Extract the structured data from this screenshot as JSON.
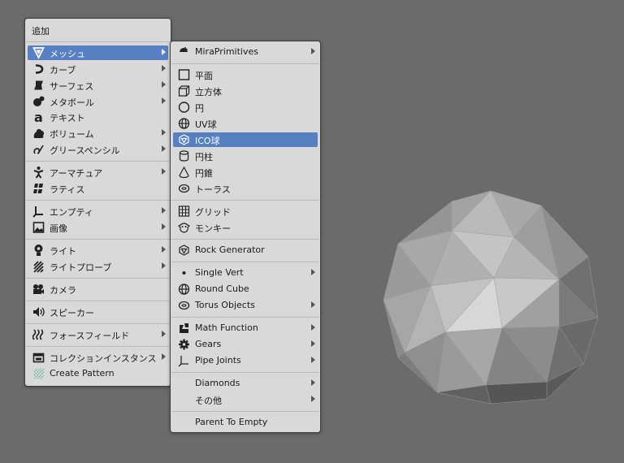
{
  "add_menu": {
    "title": "追加",
    "items": [
      {
        "label": "メッシュ",
        "icon": "mesh-icon",
        "submenu": true,
        "active": true
      },
      {
        "label": "カーブ",
        "icon": "curve-icon",
        "submenu": true
      },
      {
        "label": "サーフェス",
        "icon": "surface-icon",
        "submenu": true
      },
      {
        "label": "メタボール",
        "icon": "metaball-icon",
        "submenu": true
      },
      {
        "label": "テキスト",
        "icon": "text-icon",
        "submenu": false
      },
      {
        "label": "ボリューム",
        "icon": "volume-icon",
        "submenu": true
      },
      {
        "label": "グリースペンシル",
        "icon": "grease-pencil-icon",
        "submenu": true
      },
      {
        "label": "アーマチュア",
        "icon": "armature-icon",
        "submenu": true
      },
      {
        "label": "ラティス",
        "icon": "lattice-icon",
        "submenu": false
      },
      {
        "label": "エンプティ",
        "icon": "empty-icon",
        "submenu": true
      },
      {
        "label": "画像",
        "icon": "image-icon",
        "submenu": true
      },
      {
        "label": "ライト",
        "icon": "light-icon",
        "submenu": true
      },
      {
        "label": "ライトプローブ",
        "icon": "light-probe-icon",
        "submenu": true
      },
      {
        "label": "カメラ",
        "icon": "camera-icon",
        "submenu": false
      },
      {
        "label": "スピーカー",
        "icon": "speaker-icon",
        "submenu": false
      },
      {
        "label": "フォースフィールド",
        "icon": "force-field-icon",
        "submenu": true
      },
      {
        "label": "コレクションインスタンス",
        "icon": "collection-instance-icon",
        "submenu": true
      },
      {
        "label": "Create Pattern",
        "icon": "create-pattern-icon",
        "submenu": false
      }
    ]
  },
  "mesh_menu": {
    "items": [
      {
        "label": "MiraPrimitives",
        "icon": "mira-primitives-icon",
        "submenu": true
      },
      {
        "label": "平面",
        "icon": "plane-icon",
        "submenu": false
      },
      {
        "label": "立方体",
        "icon": "cube-icon",
        "submenu": false
      },
      {
        "label": "円",
        "icon": "circle-icon",
        "submenu": false
      },
      {
        "label": "UV球",
        "icon": "uv-sphere-icon",
        "submenu": false
      },
      {
        "label": "ICO球",
        "icon": "ico-sphere-icon",
        "submenu": false,
        "active": true
      },
      {
        "label": "円柱",
        "icon": "cylinder-icon",
        "submenu": false
      },
      {
        "label": "円錐",
        "icon": "cone-icon",
        "submenu": false
      },
      {
        "label": "トーラス",
        "icon": "torus-icon",
        "submenu": false
      },
      {
        "label": "グリッド",
        "icon": "grid-icon",
        "submenu": false
      },
      {
        "label": "モンキー",
        "icon": "monkey-icon",
        "submenu": false
      },
      {
        "label": "Rock Generator",
        "icon": "rock-generator-icon",
        "submenu": false
      },
      {
        "label": "Single Vert",
        "icon": "single-vert-icon",
        "submenu": true
      },
      {
        "label": "Round Cube",
        "icon": "round-cube-icon",
        "submenu": false
      },
      {
        "label": "Torus Objects",
        "icon": "torus-objects-icon",
        "submenu": true
      },
      {
        "label": "Math Function",
        "icon": "math-function-icon",
        "submenu": true
      },
      {
        "label": "Gears",
        "icon": "gears-icon",
        "submenu": true
      },
      {
        "label": "Pipe Joints",
        "icon": "pipe-joints-icon",
        "submenu": true
      },
      {
        "label": "Diamonds",
        "icon": "",
        "submenu": true
      },
      {
        "label": "その他",
        "icon": "",
        "submenu": true
      },
      {
        "label": "Parent To Empty",
        "icon": "",
        "submenu": false
      }
    ]
  },
  "colors": {
    "viewport_bg": "#6b6b6b",
    "menu_bg": "#d9d9d9",
    "highlight": "#5680c2"
  }
}
